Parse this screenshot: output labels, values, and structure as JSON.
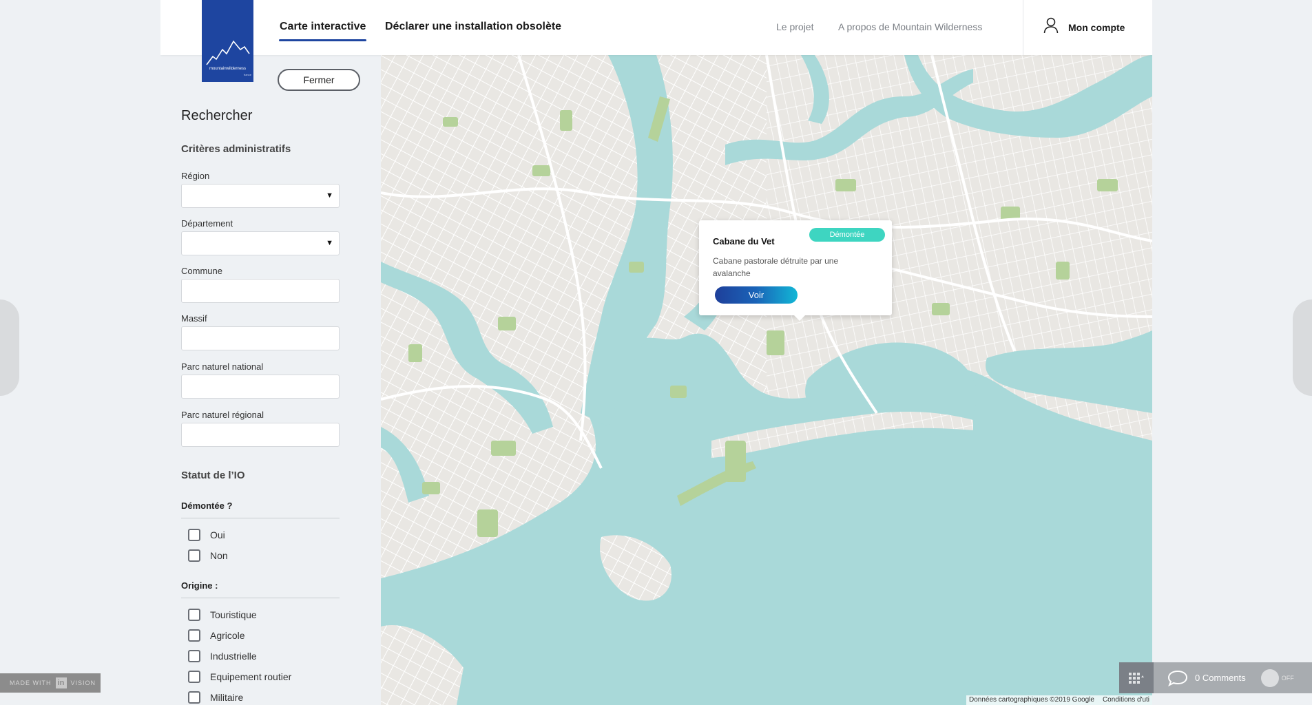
{
  "header": {
    "logo": {
      "text": "mountainwilderness",
      "sub": "france"
    },
    "nav_active": "Carte interactive",
    "nav_declare": "Déclarer une installation obsolète",
    "nav_projet": "Le projet",
    "nav_about": "A propos de Mountain Wilderness",
    "account_label": "Mon compte"
  },
  "sidebar": {
    "close_label": "Fermer",
    "search_title": "Rechercher",
    "admin_title": "Critères administratifs",
    "fields": {
      "region": {
        "label": "Région",
        "value": ""
      },
      "departement": {
        "label": "Département",
        "value": ""
      },
      "commune": {
        "label": "Commune",
        "value": ""
      },
      "massif": {
        "label": "Massif",
        "value": ""
      },
      "parc_national": {
        "label": "Parc naturel national",
        "value": ""
      },
      "parc_regional": {
        "label": "Parc naturel régional",
        "value": ""
      }
    },
    "status_title": "Statut de l’IO",
    "demontee": {
      "title": "Démontée ?",
      "options": [
        "Oui",
        "Non"
      ]
    },
    "origine": {
      "title": "Origine :",
      "options": [
        "Touristique",
        "Agricole",
        "Industrielle",
        "Equipement routier",
        "Militaire"
      ]
    }
  },
  "map": {
    "credits": "Données cartographiques ©2019 Google",
    "terms": "Conditions d'uti",
    "colors": {
      "water": "#a9d9d9",
      "land": "#e9e7e3",
      "park": "#b5d29a",
      "road": "#ffffff"
    }
  },
  "popup": {
    "badge": "Démontée",
    "badge_color": "#3ed5c1",
    "title": "Cabane du Vet",
    "description": "Cabane pastorale détruite par une avalanche",
    "button": "Voir"
  },
  "invision": {
    "made_with": "MADE WITH",
    "in": "in",
    "vision": "VISION",
    "comments": "0 Comments",
    "toggle": "OFF"
  }
}
